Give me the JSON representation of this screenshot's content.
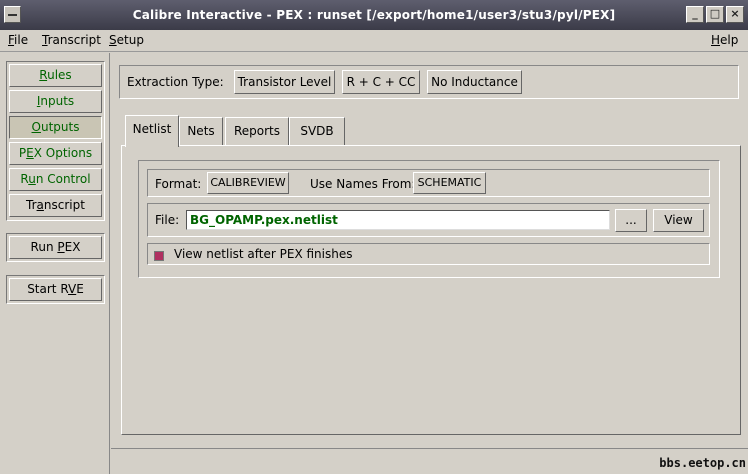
{
  "window": {
    "title": "Calibre Interactive - PEX : runset [/export/home1/user3/stu3/pyl/PEX]",
    "controls": [
      "_",
      "□",
      "×"
    ]
  },
  "menubar": {
    "file": {
      "underline": "F",
      "rest": "ile"
    },
    "transcript": {
      "underline": "T",
      "rest": "ranscript"
    },
    "setup": {
      "underline": "S",
      "rest": "etup"
    },
    "help": {
      "underline": "H",
      "rest": "elp"
    }
  },
  "sidebar": {
    "items": [
      {
        "pre": "",
        "u": "R",
        "post": "ules"
      },
      {
        "pre": "",
        "u": "I",
        "post": "nputs"
      },
      {
        "pre": "",
        "u": "O",
        "post": "utputs"
      },
      {
        "pre": "P",
        "u": "E",
        "post": "X Options"
      },
      {
        "pre": "R",
        "u": "u",
        "post": "n Control"
      },
      {
        "pre": "Tr",
        "u": "a",
        "post": "nscript"
      }
    ],
    "run_pex": {
      "pre": "Run ",
      "u": "P",
      "post": "EX"
    },
    "start_rve": {
      "pre": "Start R",
      "u": "V",
      "post": "E"
    },
    "colors": {
      "active": "#006400",
      "normal": "#000000"
    }
  },
  "extraction": {
    "label": "Extraction Type:",
    "options": [
      "Transistor Level",
      "R + C + CC",
      "No Inductance"
    ]
  },
  "tabs": [
    "Netlist",
    "Nets",
    "Reports",
    "SVDB"
  ],
  "netlist": {
    "format_label": "Format:",
    "format_value": "CALIBREVIEW",
    "use_names_label": "Use Names From:",
    "use_names_value": "SCHEMATIC",
    "file_label": "File:",
    "file_value": "BG_OPAMP.pex.netlist",
    "browse_label": "...",
    "view_label": "View",
    "checkbox_label": "View netlist after PEX finishes"
  },
  "watermark": "bbs.eetop.cn"
}
